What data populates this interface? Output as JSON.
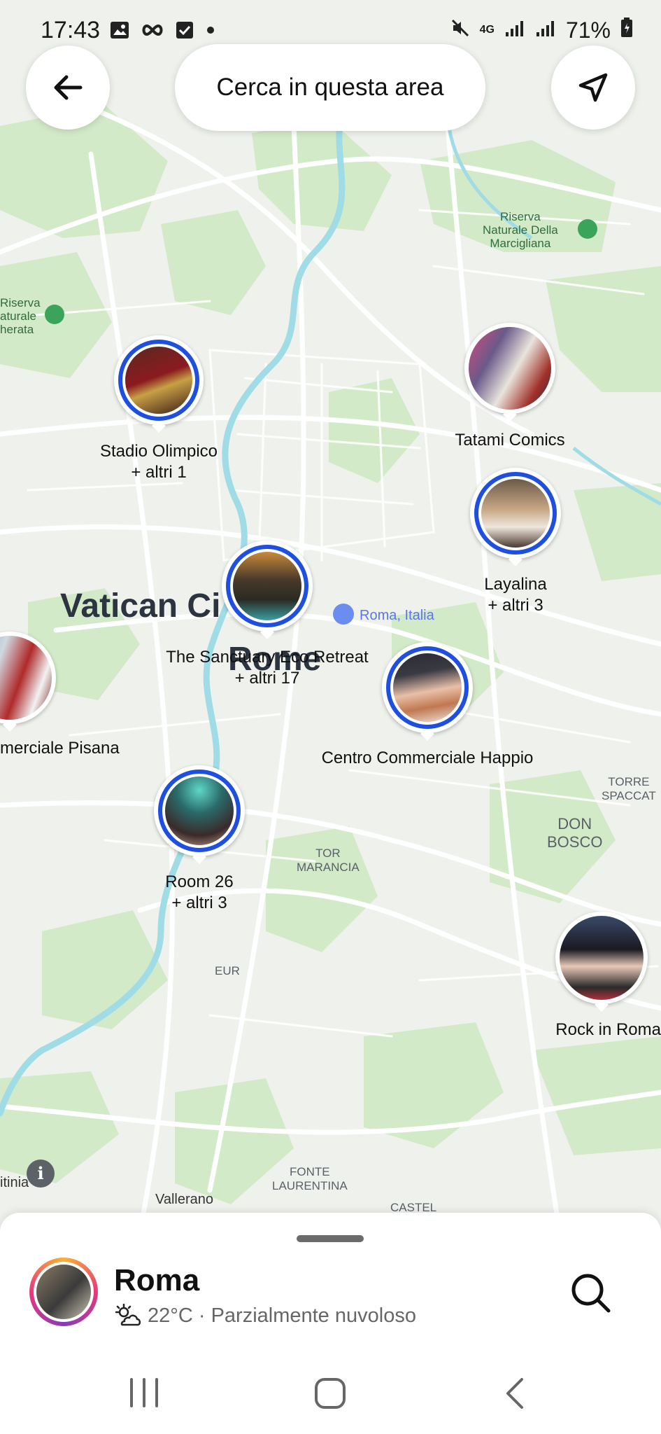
{
  "status_bar": {
    "time": "17:43",
    "network": "4G",
    "battery": "71%"
  },
  "top": {
    "search_area_label": "Cerca in questa area"
  },
  "map_labels": {
    "riserva_marcigliana": "Riserva\nNaturale Della\nMarcigliana",
    "riserva_left": "Riserva\naturale\nherata",
    "vatican": "Vatican Ci",
    "rome": "Rome",
    "roma_italia": "Roma, Italia",
    "torre_spaccata": "TORRE\nSPACCAT",
    "don_bosco": "DON\nBOSCO",
    "tor_marancia": "TOR\nMARANCIA",
    "eur": "EUR",
    "fonte_laurentina": "FONTE\nLAURENTINA",
    "vallerano": "Vallerano",
    "castel": "CASTEL",
    "itinia": "itinia"
  },
  "places": [
    {
      "name": "Stadio Olimpico",
      "extra": "+ altri 1"
    },
    {
      "name": "Tatami Comics",
      "extra": ""
    },
    {
      "name": "Layalina",
      "extra": "+ altri 3"
    },
    {
      "name": "The Sanctuary Eco Retreat",
      "extra": "+ altri 17"
    },
    {
      "name": "Centro Commerciale Happio",
      "extra": ""
    },
    {
      "name": "merciale Pisana",
      "extra": ""
    },
    {
      "name": "Room 26",
      "extra": "+ altri 3"
    },
    {
      "name": "Rock in Roma",
      "extra": ""
    }
  ],
  "sheet": {
    "title": "Roma",
    "weather": "22°C · Parzialmente nuvoloso"
  },
  "colors": {
    "ring": "#1f4fe0",
    "park": "#cfe8c4",
    "road": "#ffffff",
    "river": "#9fdce6"
  }
}
